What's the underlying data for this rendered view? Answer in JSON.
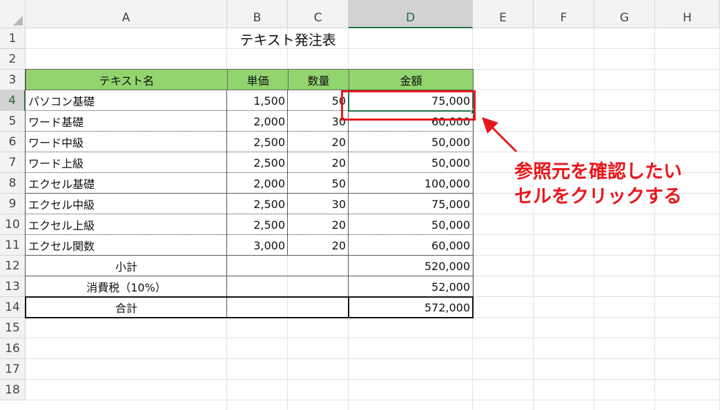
{
  "columns": [
    "A",
    "B",
    "C",
    "D",
    "E",
    "F",
    "G",
    "H"
  ],
  "active_column": "D",
  "rows": [
    "1",
    "2",
    "3",
    "4",
    "5",
    "6",
    "7",
    "8",
    "9",
    "10",
    "11",
    "12",
    "13",
    "14",
    "15",
    "16",
    "17",
    "18"
  ],
  "active_row": "4",
  "sheet_title": "テキスト発注表",
  "table": {
    "headers": [
      "テキスト名",
      "単価",
      "数量",
      "金額"
    ],
    "header_color": "#92d46e",
    "items": [
      {
        "name": "パソコン基礎",
        "price": "1,500",
        "qty": "50",
        "amount": "75,000"
      },
      {
        "name": "ワード基礎",
        "price": "2,000",
        "qty": "30",
        "amount": "60,000"
      },
      {
        "name": "ワード中級",
        "price": "2,500",
        "qty": "20",
        "amount": "50,000"
      },
      {
        "name": "ワード上級",
        "price": "2,500",
        "qty": "20",
        "amount": "50,000"
      },
      {
        "name": "エクセル基礎",
        "price": "2,000",
        "qty": "50",
        "amount": "100,000"
      },
      {
        "name": "エクセル中級",
        "price": "2,500",
        "qty": "30",
        "amount": "75,000"
      },
      {
        "name": "エクセル上級",
        "price": "2,500",
        "qty": "20",
        "amount": "50,000"
      },
      {
        "name": "エクセル関数",
        "price": "3,000",
        "qty": "20",
        "amount": "60,000"
      }
    ],
    "subtotal": {
      "label": "小計",
      "value": "520,000"
    },
    "tax": {
      "label": "消費税（10%）",
      "value": "52,000"
    },
    "total": {
      "label": "合計",
      "value": "572,000"
    }
  },
  "annotation": {
    "line1": "参照元を確認したい",
    "line2": "セルをクリックする",
    "color": "#e8171c"
  },
  "selection_color": "#1f7244"
}
